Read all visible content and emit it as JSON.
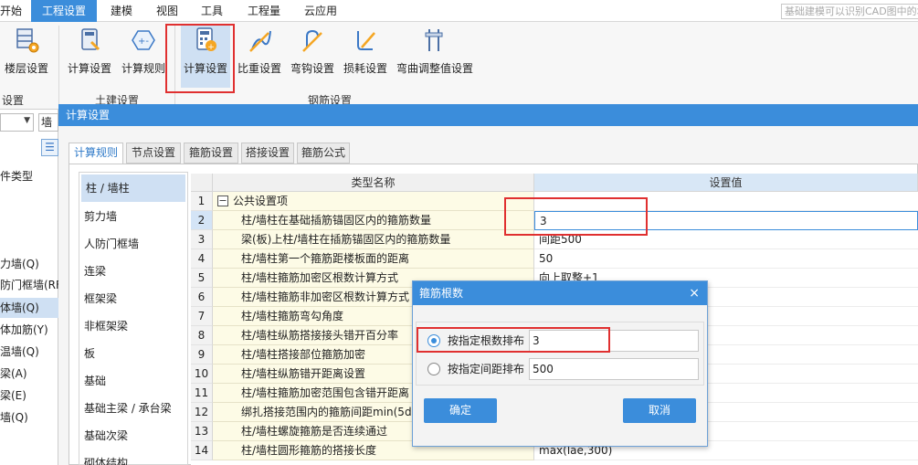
{
  "menu": {
    "items": [
      "开始",
      "工程设置",
      "建模",
      "视图",
      "工具",
      "工程量",
      "云应用"
    ],
    "active": "工程设置",
    "search_placeholder": "基础建模可以识别CAD图中的墙"
  },
  "ribbon": {
    "buttons": [
      {
        "label": "楼层设置",
        "icon": "floor-settings-icon"
      },
      {
        "label": "计算设置",
        "icon": "calc-settings-icon"
      },
      {
        "label": "计算规则",
        "icon": "calc-rules-icon"
      },
      {
        "label": "计算设置",
        "icon": "rebar-calc-settings-icon"
      },
      {
        "label": "比重设置",
        "icon": "density-settings-icon"
      },
      {
        "label": "弯钩设置",
        "icon": "hook-settings-icon"
      },
      {
        "label": "损耗设置",
        "icon": "loss-settings-icon"
      },
      {
        "label": "弯曲调整值设置",
        "icon": "bend-adjust-icon"
      }
    ],
    "groups": [
      "设置",
      "土建设置",
      "钢筋设置"
    ]
  },
  "left_panel": {
    "combo_value": "",
    "type_value": "墙",
    "items": [
      "件类型",
      "力墙(Q)",
      "防门框墙(RF)",
      "体墙(Q)",
      "体加筋(Y)",
      "温墙(Q)",
      "梁(A)",
      "梁(E)",
      "墙(Q)"
    ],
    "selected_index": 3
  },
  "dialog": {
    "title": "计算设置",
    "tabs": [
      "计算规则",
      "节点设置",
      "箍筋设置",
      "搭接设置",
      "箍筋公式"
    ],
    "active_tab": 0,
    "categories": [
      "柱 / 墙柱",
      "剪力墙",
      "人防门框墙",
      "连梁",
      "框架梁",
      "非框架梁",
      "板",
      "基础",
      "基础主梁 / 承台梁",
      "基础次梁",
      "砌体结构"
    ],
    "selected_category": 0,
    "table": {
      "headers": {
        "name": "类型名称",
        "value": "设置值"
      },
      "rows": [
        {
          "num": "1",
          "name": "公共设置项",
          "value": "",
          "is_group": true
        },
        {
          "num": "2",
          "name": "柱/墙柱在基础插筋锚固区内的箍筋数量",
          "value": "3"
        },
        {
          "num": "3",
          "name": "梁(板)上柱/墙柱在插筋锚固区内的箍筋数量",
          "value": "间距500"
        },
        {
          "num": "4",
          "name": "柱/墙柱第一个箍筋距楼板面的距离",
          "value": "50"
        },
        {
          "num": "5",
          "name": "柱/墙柱箍筋加密区根数计算方式",
          "value": "向上取整+1"
        },
        {
          "num": "6",
          "name": "柱/墙柱箍筋非加密区根数计算方式",
          "value": ""
        },
        {
          "num": "7",
          "name": "柱/墙柱箍筋弯勾角度",
          "value": ""
        },
        {
          "num": "8",
          "name": "柱/墙柱纵筋搭接接头错开百分率",
          "value": ""
        },
        {
          "num": "9",
          "name": "柱/墙柱搭接部位箍筋加密",
          "value": ""
        },
        {
          "num": "10",
          "name": "柱/墙柱纵筋错开距离设置",
          "value": ""
        },
        {
          "num": "11",
          "name": "柱/墙柱箍筋加密范围包含错开距离",
          "value": ""
        },
        {
          "num": "12",
          "name": "绑扎搭接范围内的箍筋间距min(5d,",
          "value": ""
        },
        {
          "num": "13",
          "name": "柱/墙柱螺旋箍筋是否连续通过",
          "value": ""
        },
        {
          "num": "14",
          "name": "柱/墙柱圆形箍筋的搭接长度",
          "value": "max(lae,300)"
        }
      ],
      "selected_row": 1
    }
  },
  "popup": {
    "title": "箍筋根数",
    "options": [
      {
        "label": "按指定根数排布",
        "value": "3",
        "selected": true
      },
      {
        "label": "按指定间距排布",
        "value": "500",
        "selected": false
      }
    ],
    "ok_label": "确定",
    "cancel_label": "取消",
    "close_glyph": "×"
  },
  "colors": {
    "accent": "#3b8ddb",
    "highlight_red": "#e03030",
    "selection": "#cfe0f3"
  }
}
